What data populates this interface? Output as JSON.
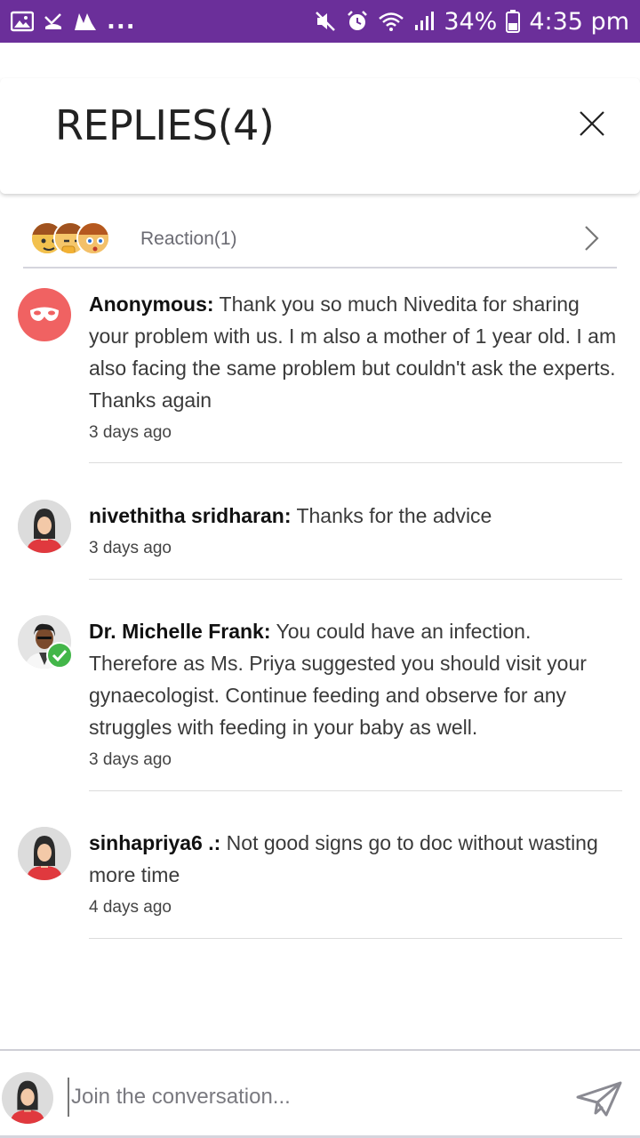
{
  "status_bar": {
    "overflow": "...",
    "battery": "34%",
    "time": "4:35 pm",
    "icons_left": [
      "gallery-icon",
      "missed-call-icon",
      "app-m-icon"
    ],
    "icons_right": [
      "mute-icon",
      "alarm-icon",
      "wifi-icon",
      "signal-icon",
      "battery-icon"
    ]
  },
  "header": {
    "title": "REPLIES(4)"
  },
  "reactions": {
    "label": "Reaction(1)"
  },
  "replies": [
    {
      "author": "Anonymous:",
      "text": " Thank you so much Nivedita for sharing your problem with us. I m also a mother of 1 year old. I am also facing the same problem but couldn't ask the experts. Thanks again",
      "time": "3 days ago",
      "avatar": "anonymous-mask-icon"
    },
    {
      "author": "nivethitha sridharan:",
      "text": " Thanks for the advice",
      "time": "3 days ago",
      "avatar": "default-female-avatar"
    },
    {
      "author": "Dr. Michelle Frank:",
      "text": " You could have an infection. Therefore as Ms. Priya suggested you should visit your gynaecologist. Continue feeding and observe for any struggles with feeding in your baby as well.",
      "time": "3 days ago",
      "avatar": "doctor-photo-avatar"
    },
    {
      "author": "sinhapriya6 .:",
      "text": " Not good signs go to doc without wasting more time",
      "time": "4 days ago",
      "avatar": "default-female-avatar"
    }
  ],
  "compose": {
    "placeholder": "Join the conversation..."
  },
  "colors": {
    "status_bar": "#6b2f9a",
    "anonymous_avatar": "#f06262",
    "verified_badge": "#43b649",
    "avatar_shirt": "#e0393e"
  }
}
